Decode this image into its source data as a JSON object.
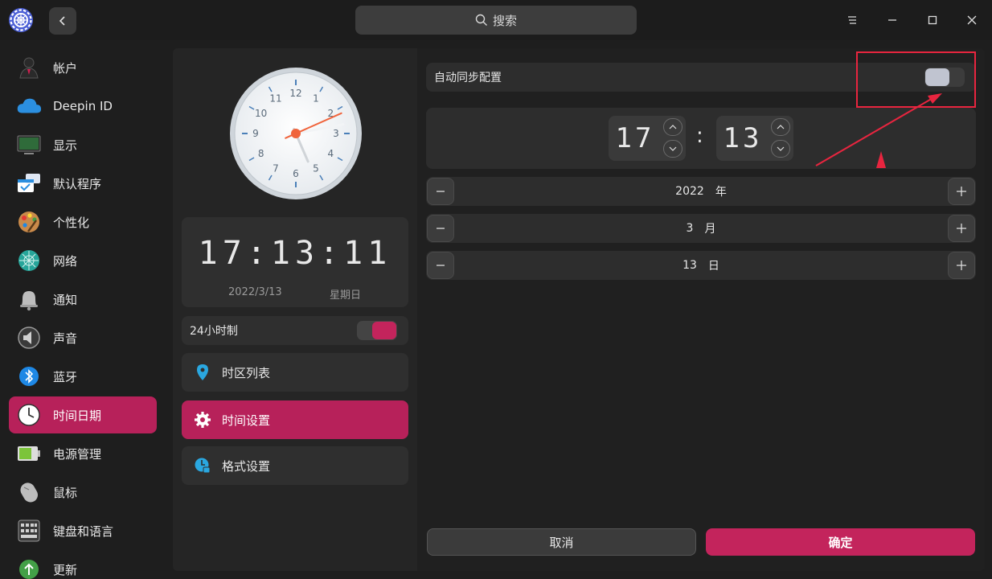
{
  "titlebar": {
    "search_placeholder": "搜索"
  },
  "sidebar": {
    "items": [
      {
        "label": "帐户",
        "icon": "account-icon"
      },
      {
        "label": "Deepin ID",
        "icon": "cloud-icon"
      },
      {
        "label": "显示",
        "icon": "display-icon"
      },
      {
        "label": "默认程序",
        "icon": "default-apps-icon"
      },
      {
        "label": "个性化",
        "icon": "palette-icon"
      },
      {
        "label": "网络",
        "icon": "network-icon"
      },
      {
        "label": "通知",
        "icon": "bell-icon"
      },
      {
        "label": "声音",
        "icon": "speaker-icon"
      },
      {
        "label": "蓝牙",
        "icon": "bluetooth-icon"
      },
      {
        "label": "时间日期",
        "icon": "clock-icon"
      },
      {
        "label": "电源管理",
        "icon": "battery-icon"
      },
      {
        "label": "鼠标",
        "icon": "mouse-icon"
      },
      {
        "label": "键盘和语言",
        "icon": "keyboard-icon"
      },
      {
        "label": "更新",
        "icon": "update-icon"
      }
    ],
    "active_index": 9
  },
  "clock": {
    "numbers": [
      "12",
      "1",
      "2",
      "3",
      "4",
      "5",
      "6",
      "7",
      "8",
      "9",
      "10",
      "11"
    ],
    "hour": 17,
    "minute": 13,
    "second": 11
  },
  "digital": {
    "time": "17:13:11",
    "date": "2022/3/13",
    "weekday": "星期日"
  },
  "format24": {
    "label": "24小时制",
    "enabled": true
  },
  "mid_menu": {
    "items": [
      {
        "label": "时区列表",
        "icon": "location-pin-icon"
      },
      {
        "label": "时间设置",
        "icon": "gear-icon"
      },
      {
        "label": "格式设置",
        "icon": "format-clock-icon"
      }
    ],
    "active_index": 1
  },
  "settings": {
    "auto_sync_label": "自动同步配置",
    "auto_sync_enabled": false,
    "hour": "17",
    "minute": "13",
    "year_value": "2022",
    "year_unit": "年",
    "month_value": "3",
    "month_unit": "月",
    "day_value": "13",
    "day_unit": "日",
    "cancel_label": "取消",
    "confirm_label": "确定"
  },
  "colors": {
    "accent": "#c3245c",
    "annotation": "#e8253f"
  }
}
